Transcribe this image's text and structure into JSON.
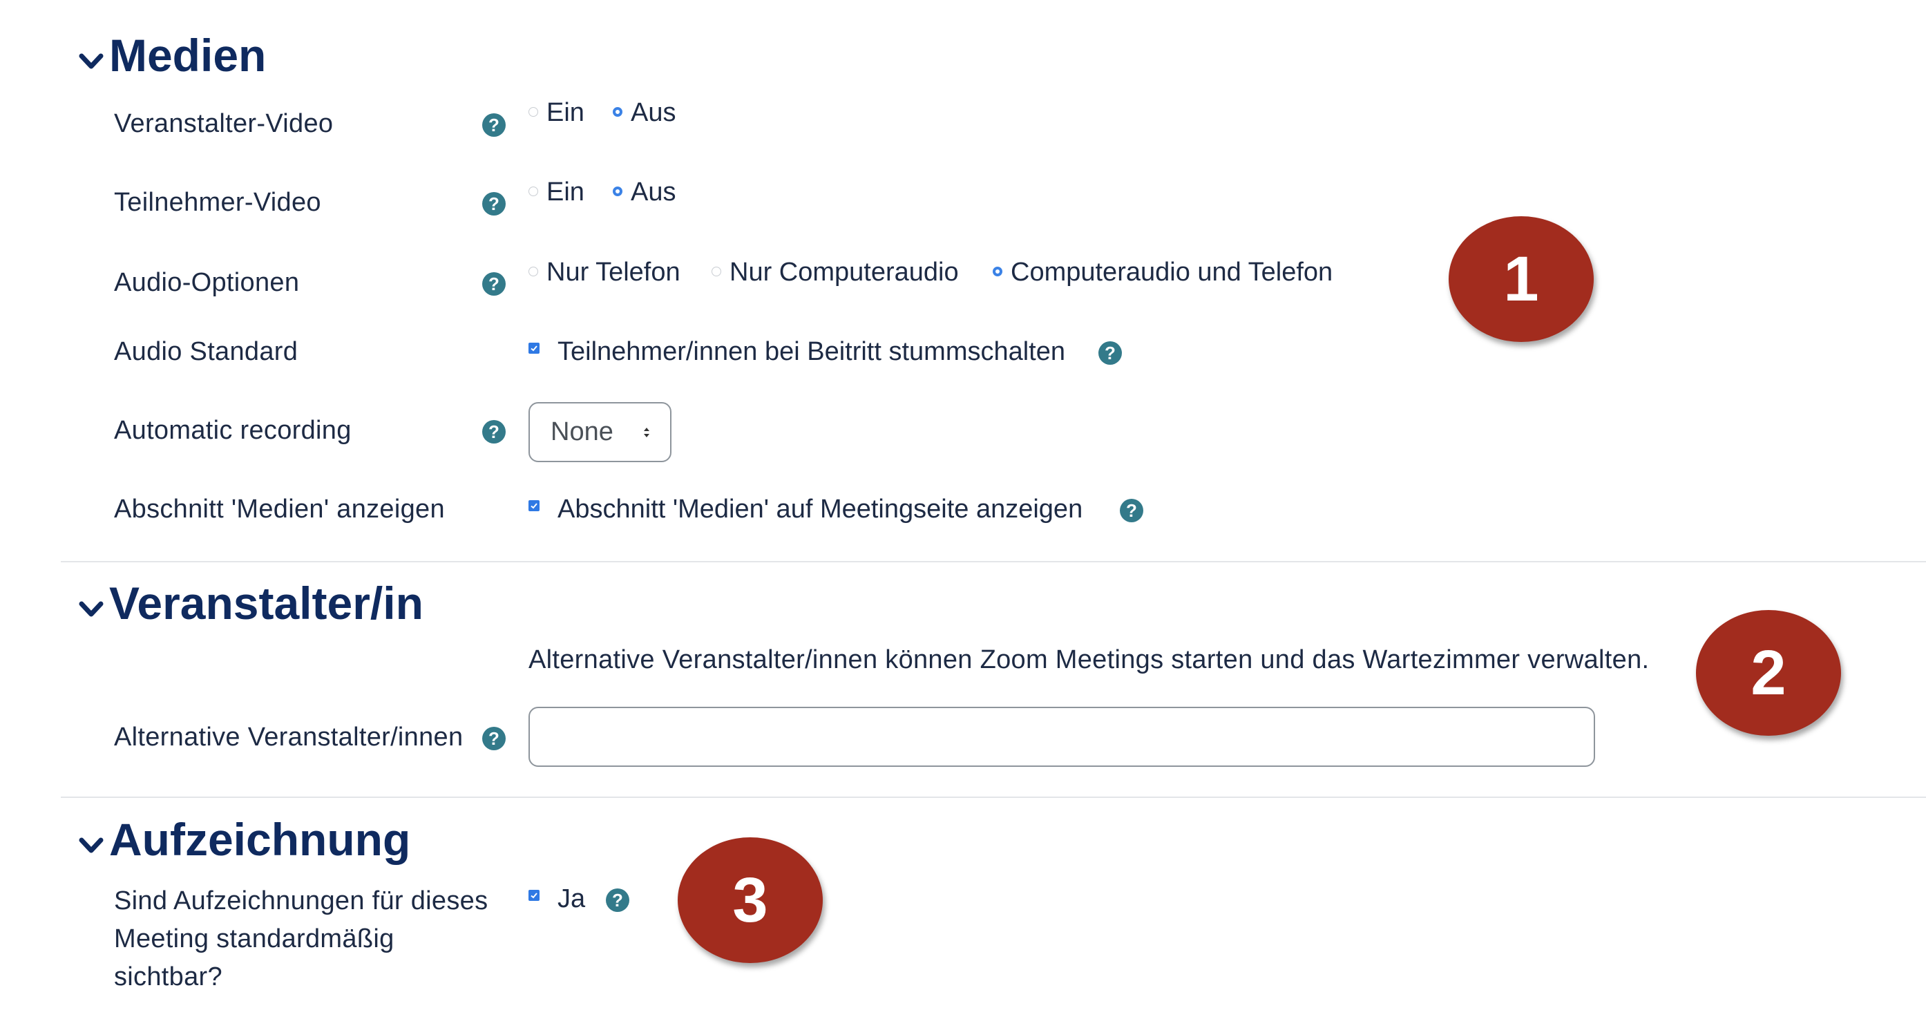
{
  "sections": {
    "medien": {
      "title": "Medien",
      "rows": {
        "host_video": {
          "label": "Veranstalter-Video",
          "options": [
            "Ein",
            "Aus"
          ],
          "selected": "Aus"
        },
        "participant_video": {
          "label": "Teilnehmer-Video",
          "options": [
            "Ein",
            "Aus"
          ],
          "selected": "Aus"
        },
        "audio_options": {
          "label": "Audio-Optionen",
          "options": [
            "Nur Telefon",
            "Nur Computeraudio",
            "Computeraudio und Telefon"
          ],
          "selected": "Computeraudio und Telefon"
        },
        "audio_default": {
          "label": "Audio Standard",
          "checkbox_label": "Teilnehmer/innen bei Beitritt stummschalten",
          "checked": true
        },
        "auto_recording": {
          "label": "Automatic recording",
          "value": "None"
        },
        "show_media": {
          "label": "Abschnitt 'Medien' anzeigen",
          "checkbox_label": "Abschnitt 'Medien' auf Meetingseite anzeigen",
          "checked": true
        }
      }
    },
    "host": {
      "title": "Veranstalter/in",
      "description": "Alternative Veranstalter/innen können Zoom Meetings starten und das Wartezimmer verwalten.",
      "alt_hosts": {
        "label": "Alternative Veranstalter/innen",
        "value": ""
      }
    },
    "recording": {
      "title": "Aufzeichnung",
      "visible": {
        "label_lines": [
          "Sind Aufzeichnungen für dieses",
          "Meeting standardmäßig",
          "sichtbar?"
        ],
        "checkbox_label": "Ja",
        "checked": true
      }
    }
  },
  "callouts": [
    "1",
    "2",
    "3"
  ],
  "colors": {
    "heading": "#0f2a5f",
    "help_icon": "#337a8a",
    "radio_checked": "#3b82e6",
    "checkbox": "#2f79e4",
    "callout": "#a22c1e"
  }
}
